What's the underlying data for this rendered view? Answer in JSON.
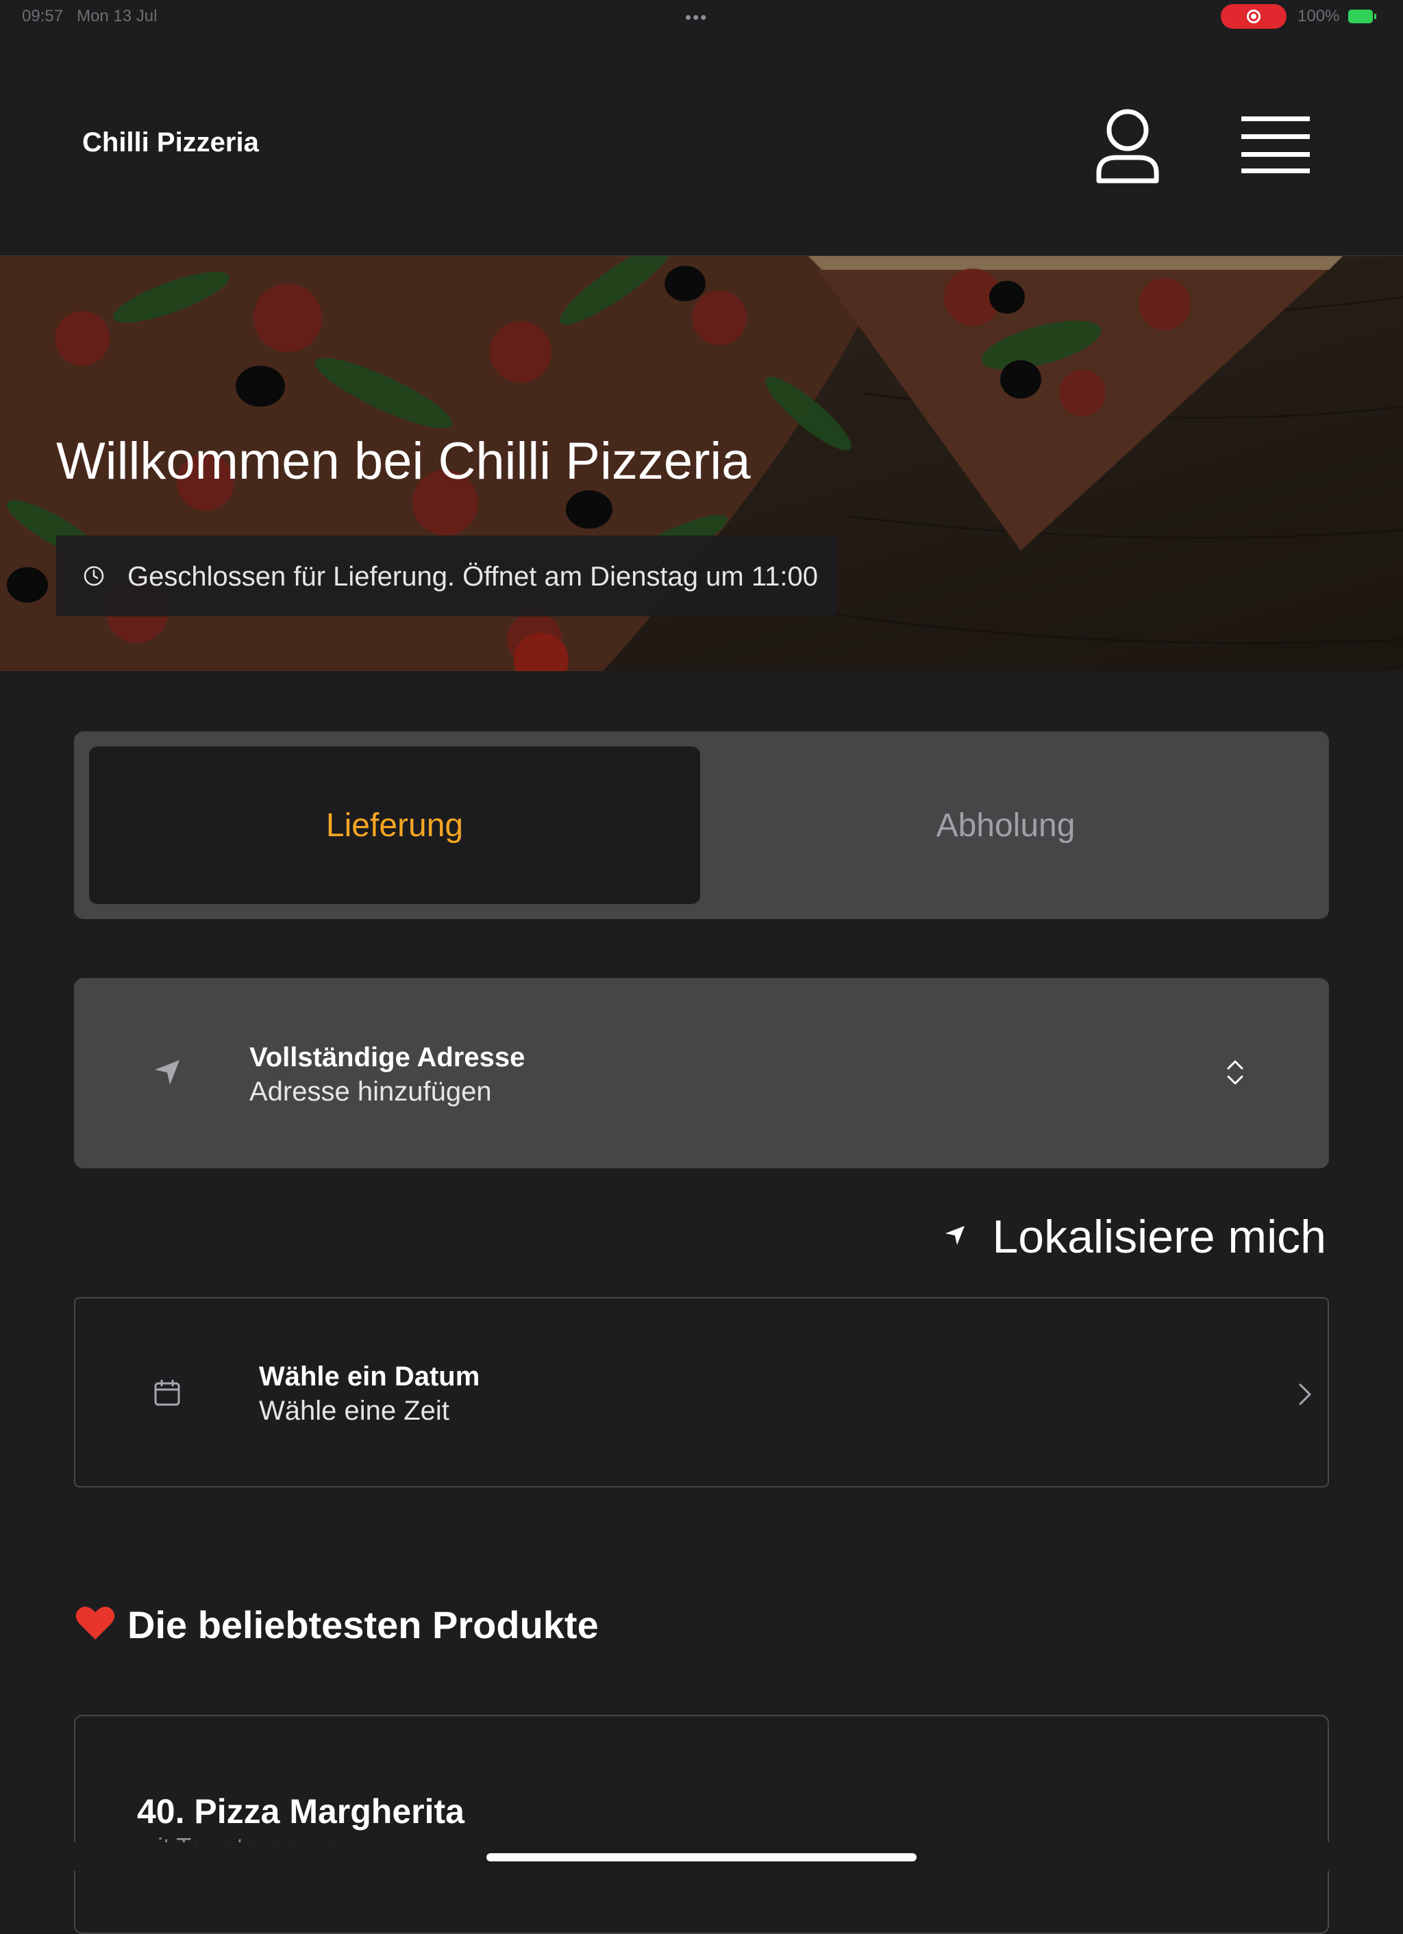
{
  "status_bar": {
    "time": "09:57",
    "date": "Mon 13 Jul",
    "battery": "100%",
    "colors": {
      "recording": "#e0282e",
      "battery": "#30d158"
    }
  },
  "header": {
    "brand": "Chilli Pizzeria",
    "icons": [
      "user-icon",
      "hamburger-menu-icon"
    ]
  },
  "hero": {
    "title": "Willkommen bei Chilli Pizzeria",
    "status": "Geschlossen für Lieferung. Öffnet am Dienstag um 11:00"
  },
  "mode_toggle": {
    "options": [
      "Lieferung",
      "Abholung"
    ],
    "selected": "Lieferung",
    "accent_color": "#f5a623"
  },
  "address": {
    "title": "Vollständige Adresse",
    "subtitle": "Adresse hinzufügen"
  },
  "locate": {
    "label": "Lokalisiere mich"
  },
  "date": {
    "title": "Wähle ein Datum",
    "subtitle": "Wähle eine Zeit"
  },
  "popular": {
    "title": "Die beliebtesten Produkte",
    "products": [
      {
        "name": "40. Pizza Margherita",
        "desc": "mit Tomatensauce"
      }
    ]
  }
}
